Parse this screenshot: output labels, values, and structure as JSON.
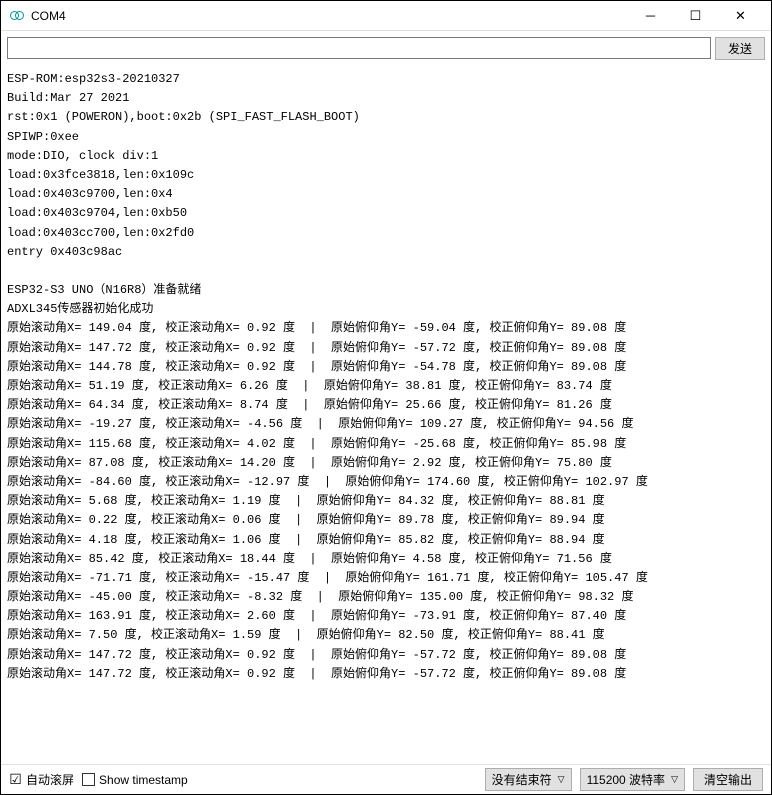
{
  "window": {
    "title": "COM4"
  },
  "toolbar": {
    "input_value": "",
    "send_label": "发送"
  },
  "boot_lines": [
    "ESP-ROM:esp32s3-20210327",
    "Build:Mar 27 2021",
    "rst:0x1 (POWERON),boot:0x2b (SPI_FAST_FLASH_BOOT)",
    "SPIWP:0xee",
    "mode:DIO, clock div:1",
    "load:0x3fce3818,len:0x109c",
    "load:0x403c9700,len:0x4",
    "load:0x403c9704,len:0xb50",
    "load:0x403cc700,len:0x2fd0",
    "entry 0x403c98ac",
    "",
    "ESP32-S3 UNO（N16R8）准备就绪",
    "ADXL345传感器初始化成功"
  ],
  "data_rows": [
    {
      "raw_roll": "149.04",
      "corr_roll": "0.92",
      "raw_pitch": "-59.04",
      "corr_pitch": "89.08"
    },
    {
      "raw_roll": "147.72",
      "corr_roll": "0.92",
      "raw_pitch": "-57.72",
      "corr_pitch": "89.08"
    },
    {
      "raw_roll": "144.78",
      "corr_roll": "0.92",
      "raw_pitch": "-54.78",
      "corr_pitch": "89.08"
    },
    {
      "raw_roll": "51.19",
      "corr_roll": "6.26",
      "raw_pitch": "38.81",
      "corr_pitch": "83.74"
    },
    {
      "raw_roll": "64.34",
      "corr_roll": "8.74",
      "raw_pitch": "25.66",
      "corr_pitch": "81.26"
    },
    {
      "raw_roll": "-19.27",
      "corr_roll": "-4.56",
      "raw_pitch": "109.27",
      "corr_pitch": "94.56"
    },
    {
      "raw_roll": "115.68",
      "corr_roll": "4.02",
      "raw_pitch": "-25.68",
      "corr_pitch": "85.98"
    },
    {
      "raw_roll": "87.08",
      "corr_roll": "14.20",
      "raw_pitch": "2.92",
      "corr_pitch": "75.80"
    },
    {
      "raw_roll": "-84.60",
      "corr_roll": "-12.97",
      "raw_pitch": "174.60",
      "corr_pitch": "102.97"
    },
    {
      "raw_roll": "5.68",
      "corr_roll": "1.19",
      "raw_pitch": "84.32",
      "corr_pitch": "88.81"
    },
    {
      "raw_roll": "0.22",
      "corr_roll": "0.06",
      "raw_pitch": "89.78",
      "corr_pitch": "89.94"
    },
    {
      "raw_roll": "4.18",
      "corr_roll": "1.06",
      "raw_pitch": "85.82",
      "corr_pitch": "88.94"
    },
    {
      "raw_roll": "85.42",
      "corr_roll": "18.44",
      "raw_pitch": "4.58",
      "corr_pitch": "71.56"
    },
    {
      "raw_roll": "-71.71",
      "corr_roll": "-15.47",
      "raw_pitch": "161.71",
      "corr_pitch": "105.47"
    },
    {
      "raw_roll": "-45.00",
      "corr_roll": "-8.32",
      "raw_pitch": "135.00",
      "corr_pitch": "98.32"
    },
    {
      "raw_roll": "163.91",
      "corr_roll": "2.60",
      "raw_pitch": "-73.91",
      "corr_pitch": "87.40"
    },
    {
      "raw_roll": "7.50",
      "corr_roll": "1.59",
      "raw_pitch": "82.50",
      "corr_pitch": "88.41"
    },
    {
      "raw_roll": "147.72",
      "corr_roll": "0.92",
      "raw_pitch": "-57.72",
      "corr_pitch": "89.08"
    },
    {
      "raw_roll": "147.72",
      "corr_roll": "0.92",
      "raw_pitch": "-57.72",
      "corr_pitch": "89.08"
    }
  ],
  "labels": {
    "raw_roll": "原始滚动角X=",
    "corr_roll": "校正滚动角X=",
    "raw_pitch": "原始俯仰角Y=",
    "corr_pitch": "校正俯仰角Y=",
    "deg": "度"
  },
  "footer": {
    "autoscroll_label": "自动滚屏",
    "autoscroll_checked": true,
    "timestamp_label": "Show timestamp",
    "timestamp_checked": false,
    "line_ending": "没有结束符",
    "baud_rate": "115200 波特率",
    "clear_label": "清空输出"
  }
}
